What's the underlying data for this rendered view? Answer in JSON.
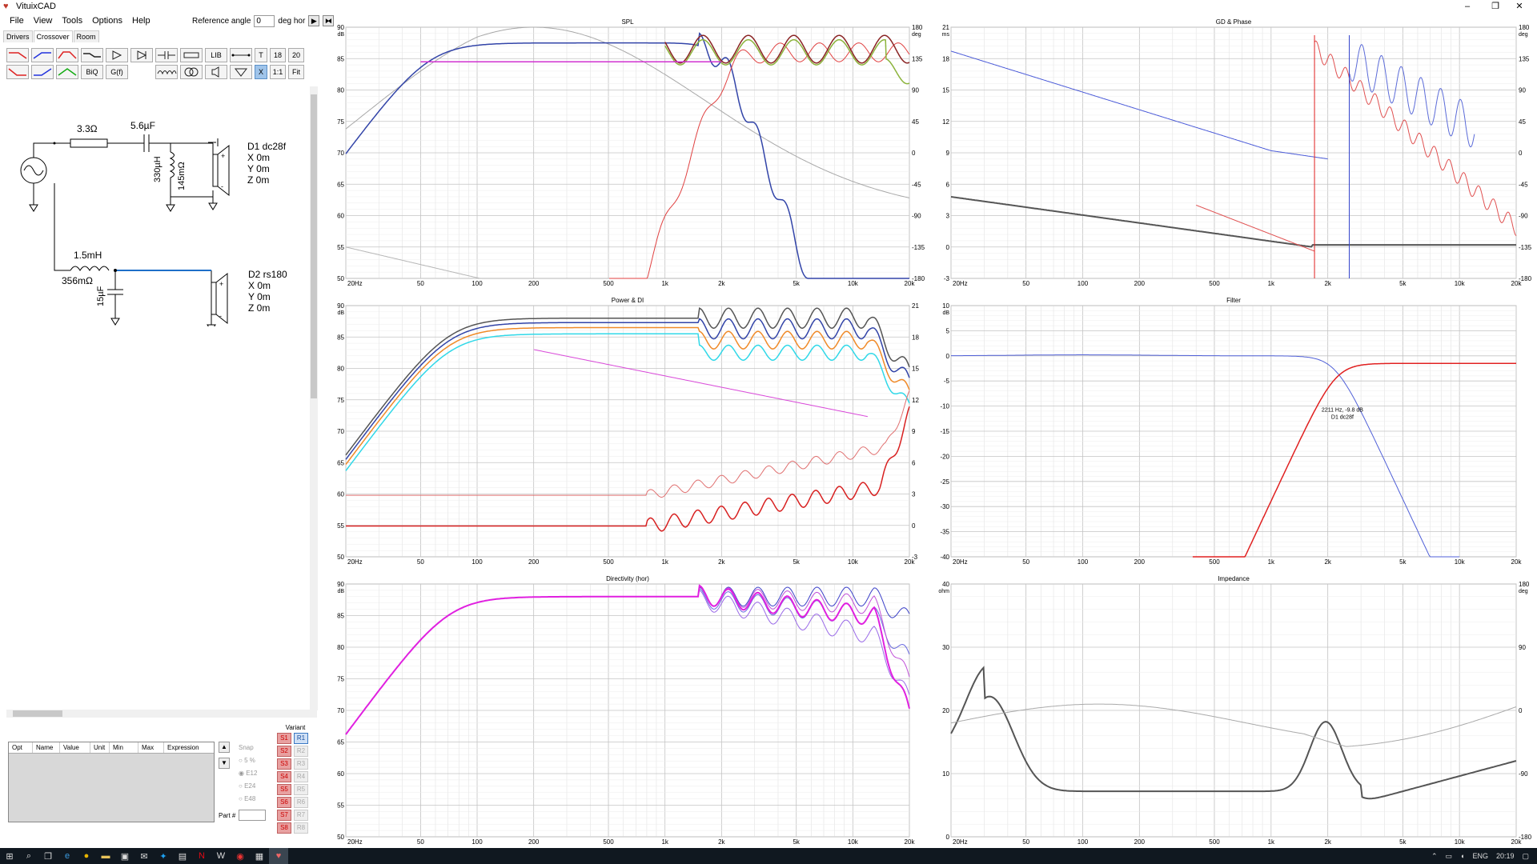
{
  "window": {
    "title": "VituixCAD",
    "min": "–",
    "max": "❐",
    "close": "✕"
  },
  "menu": [
    "File",
    "View",
    "Tools",
    "Options",
    "Help"
  ],
  "reference_angle": {
    "label": "Reference angle",
    "value": "0",
    "unit": "deg hor"
  },
  "tabs": [
    "Drivers",
    "Crossover",
    "Room"
  ],
  "toolbar": {
    "lib": "LIB",
    "t": "T",
    "n18": "18",
    "n20": "20",
    "biq": "BiQ",
    "gf": "G(f)",
    "x": "X",
    "one_one": "1:1",
    "fit": "Fit"
  },
  "schematic": {
    "r1": "3.3Ω",
    "c1": "5.6µF",
    "l1": "330µH",
    "l1_r": "145mΩ",
    "l2": "1.5mH",
    "l2_r": "356mΩ",
    "c2": "15µF",
    "d1": {
      "name": "D1 dc28f",
      "x": "X 0m",
      "y": "Y 0m",
      "z": "Z 0m"
    },
    "d2": {
      "name": "D2 rs180",
      "x": "X 0m",
      "y": "Y 0m",
      "z": "Z 0m"
    }
  },
  "opt_table": {
    "columns": [
      "Opt",
      "Name",
      "Value",
      "Unit",
      "Min",
      "Max",
      "Expression"
    ]
  },
  "snap": {
    "label": "Snap",
    "options": [
      "5 %",
      "E12",
      "E24",
      "E48"
    ]
  },
  "variant": {
    "label": "Variant",
    "s": [
      "S1",
      "S2",
      "S3",
      "S4",
      "S5",
      "S6",
      "S7",
      "S8"
    ],
    "r": [
      "R1",
      "R2",
      "R3",
      "R4",
      "R5",
      "R6",
      "R7",
      "R8"
    ]
  },
  "part_label": "Part #",
  "freq_ticks": [
    "20Hz",
    "50",
    "100",
    "200",
    "500",
    "1k",
    "2k",
    "5k",
    "10k",
    "20k"
  ],
  "graphs": {
    "spl": {
      "title": "SPL",
      "left_unit": "dB",
      "right_unit": "deg",
      "left_ticks": [
        "90",
        "85",
        "80",
        "75",
        "70",
        "65",
        "60",
        "55",
        "50"
      ],
      "right_ticks": [
        "180",
        "135",
        "90",
        "45",
        "0",
        "-45",
        "-90",
        "-135",
        "-180"
      ]
    },
    "gd": {
      "title": "GD & Phase",
      "left_unit": "ms",
      "right_unit": "deg",
      "left_ticks": [
        "21",
        "18",
        "15",
        "12",
        "9",
        "6",
        "3",
        "0",
        "-3"
      ],
      "right_ticks": [
        "180",
        "135",
        "90",
        "45",
        "0",
        "-45",
        "-90",
        "-135",
        "-180"
      ]
    },
    "power": {
      "title": "Power & DI",
      "left_unit": "dB",
      "right_unit": "",
      "left_ticks": [
        "90",
        "85",
        "80",
        "75",
        "70",
        "65",
        "60",
        "55",
        "50"
      ],
      "right_ticks": [
        "21",
        "18",
        "15",
        "12",
        "9",
        "6",
        "3",
        "0",
        "-3"
      ]
    },
    "filter": {
      "title": "Filter",
      "left_unit": "dB",
      "left_ticks": [
        "10",
        "5",
        "0",
        "-5",
        "-10",
        "-15",
        "-20",
        "-25",
        "-30",
        "-35",
        "-40"
      ],
      "annotation_1": "2211 Hz, -9.8 dB",
      "annotation_2": "D1 dc28f"
    },
    "directivity": {
      "title": "Directivity (hor)",
      "left_unit": "dB",
      "left_ticks": [
        "90",
        "85",
        "80",
        "75",
        "70",
        "65",
        "60",
        "55",
        "50"
      ]
    },
    "impedance": {
      "title": "Impedance",
      "left_unit": "ohm",
      "right_unit": "deg",
      "left_ticks": [
        "40",
        "30",
        "20",
        "10",
        "0"
      ],
      "right_ticks": [
        "180",
        "90",
        "0",
        "-90",
        "-180"
      ]
    }
  },
  "taskbar": {
    "lang": "ENG",
    "time": "20:19"
  }
}
